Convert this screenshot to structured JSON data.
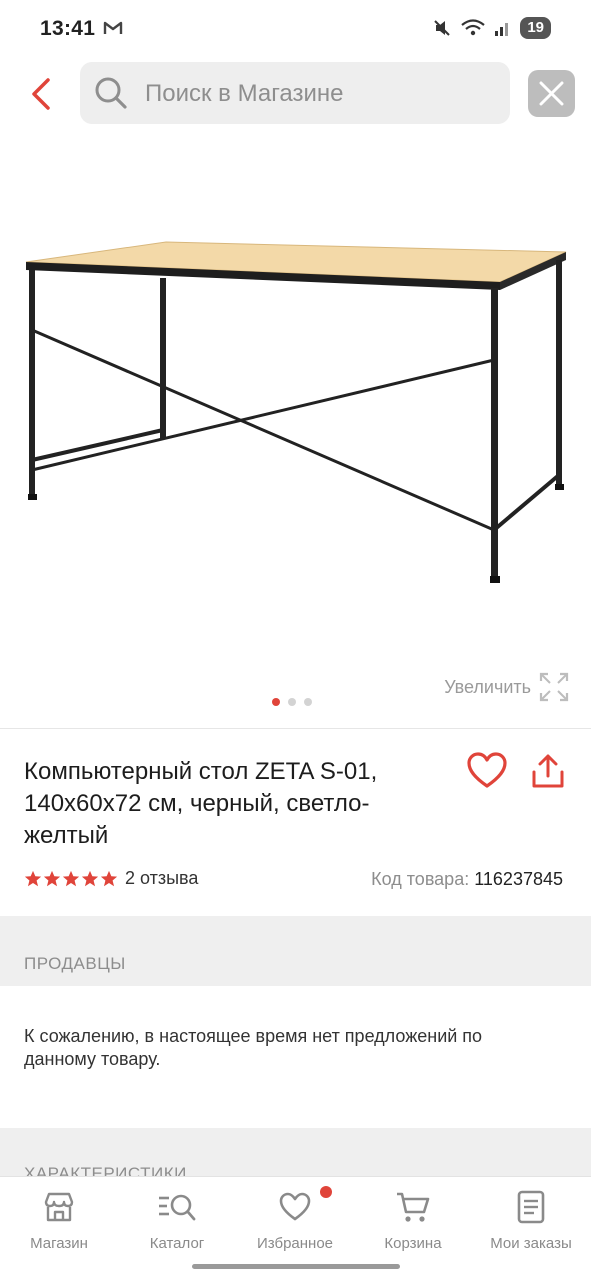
{
  "status_bar": {
    "time": "13:41",
    "battery": "19"
  },
  "search": {
    "placeholder": "Поиск в Магазине"
  },
  "gallery": {
    "zoom_label": "Увеличить",
    "pages": 3,
    "active_page": 1
  },
  "product": {
    "title": "Компьютерный стол ZETA S-01, 140x60x72 см, черный, светло-желтый",
    "rating": 5,
    "reviews": "2 отзыва",
    "sku_label": "Код товара:",
    "sku_value": "116237845"
  },
  "sellers": {
    "heading": "ПРОДАВЦЫ",
    "message": "К сожалению, в настоящее время нет предложений по данному товару."
  },
  "specs": {
    "heading": "ХАРАКТЕРИСТИКИ"
  },
  "nav": {
    "items": [
      {
        "label": "Магазин",
        "icon": "store-icon"
      },
      {
        "label": "Каталог",
        "icon": "catalog-search-icon"
      },
      {
        "label": "Избранное",
        "icon": "heart-icon"
      },
      {
        "label": "Корзина",
        "icon": "cart-icon"
      },
      {
        "label": "Мои заказы",
        "icon": "orders-icon"
      }
    ]
  },
  "colors": {
    "accent": "#e0443a",
    "muted": "#8d8d8d",
    "band": "#efefef"
  }
}
